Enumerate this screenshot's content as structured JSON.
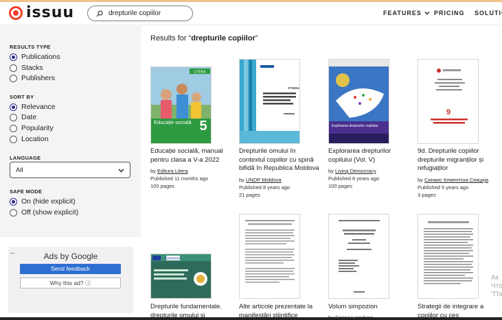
{
  "header": {
    "logo_text": "issuu",
    "search_value": "drepturile copiilor",
    "nav_features": "FEATURES",
    "nav_pricing": "PRICING",
    "nav_solutions": "SOLUTIONS"
  },
  "filters": {
    "results_type_title": "RESULTS TYPE",
    "results_type": [
      "Publications",
      "Stacks",
      "Publishers"
    ],
    "sort_by_title": "SORT BY",
    "sort_by": [
      "Relevance",
      "Date",
      "Popularity",
      "Location"
    ],
    "language_title": "LANGUAGE",
    "language_value": "All",
    "safe_mode_title": "SAFE MODE",
    "safe_mode": [
      "On (hide explicit)",
      "Off (show explicit)"
    ]
  },
  "ad": {
    "back": "←",
    "title": "Ads by Google",
    "feedback": "Send feedback",
    "why": "Why this ad? ⓘ"
  },
  "results": {
    "prefix": "Results for “",
    "query": "drepturile copiilor",
    "suffix": "”",
    "items": [
      {
        "title": "Educație socială, manual pentru clasa a V-a 2022",
        "by": "by",
        "publisher": "Editura Litera",
        "published": "Published 11 months ago",
        "pages": "100 pages"
      },
      {
        "title": "Drepturile omului în contextul copiilor cu spină bifidă în Republica Moldova",
        "by": "by",
        "publisher": "UNDP Moldova",
        "published": "Published 8 years ago",
        "pages": "21 pages"
      },
      {
        "title": "Explorarea drepturilor copilului (Vol. V)",
        "by": "by",
        "publisher": "Living Democracy",
        "published": "Published 6 years ago",
        "pages": "100 pages"
      },
      {
        "title": "9d. Drepturile copiilor drepturile migranților și refugiaților",
        "by": "by",
        "publisher": "Синаис Клиентска Секција",
        "published": "Published 5 years ago",
        "pages": "3 pages"
      },
      {
        "title": "Drepturile fundamentale. drepturile omului și",
        "by": "",
        "publisher": "",
        "published": "",
        "pages": ""
      },
      {
        "title": "Alte articole prezentate la manifestări științifice",
        "by": "",
        "publisher": "",
        "published": "",
        "pages": ""
      },
      {
        "title": "Volum simpozion",
        "by": "by",
        "publisher": "Sonea Loredana",
        "published": "",
        "pages": ""
      },
      {
        "title": "Strategii de integrare a copiilor cu ces",
        "by": "",
        "publisher": "",
        "published": "",
        "pages": ""
      }
    ]
  },
  "covers": {
    "c1_brand": "LITERA",
    "c1_label": "Educație socială",
    "c1_number": "5",
    "c2_label": "STUDIU",
    "c3_label": "Explorarea drepturilor copilului",
    "c4_number": "9",
    "c5_badge": "Erasmus+"
  },
  "overflow_text": "Ак Что \"Па",
  "colors": {
    "accent": "#f33f2c",
    "radio": "#2b2a8a",
    "ad_button": "#2f6fd1"
  }
}
